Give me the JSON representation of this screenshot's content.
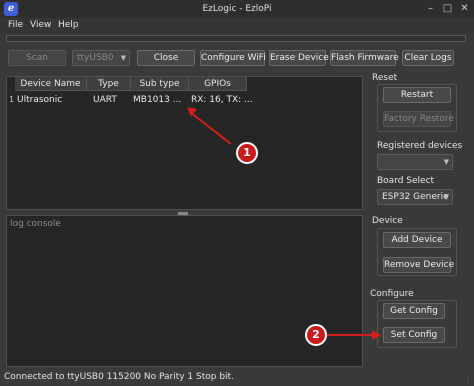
{
  "window": {
    "title": "EzLogic - EzloPi",
    "app_icon_glyph": "ℯ"
  },
  "menu": [
    "File",
    "View",
    "Help"
  ],
  "toolbar": {
    "scan_label": "Scan",
    "port_value": "ttyUSB0",
    "close_label": "Close",
    "configure_wifi_label": "Configure WiFi",
    "erase_device_label": "Erase Device",
    "flash_firmware_label": "Flash Firmware",
    "clear_logs_label": "Clear Logs"
  },
  "table": {
    "columns": [
      "Device Name",
      "Type",
      "Sub type",
      "GPIOs"
    ],
    "rows": [
      {
        "num": "1",
        "device_name": "Ultrasonic",
        "type": "UART",
        "sub_type": "MB1013 ...",
        "gpios": "RX: 16, TX: ..."
      }
    ]
  },
  "console": {
    "placeholder": "log console"
  },
  "sidebar": {
    "reset_label": "Reset",
    "restart_label": "Restart",
    "factory_restore_label": "Factory Restore",
    "registered_devices_label": "Registered devices",
    "registered_devices_value": "",
    "board_select_label": "Board Select",
    "board_value": "ESP32 Generic",
    "device_label": "Device",
    "add_device_label": "Add Device",
    "remove_device_label": "Remove Device",
    "configure_label": "Configure",
    "get_config_label": "Get Config",
    "set_config_label": "Set Config"
  },
  "status_bar": {
    "text": "Connected to ttyUSB0 115200 No Parity 1 Stop bit."
  },
  "annotations": [
    {
      "label": "1",
      "color": "#c81c1c"
    },
    {
      "label": "2",
      "color": "#c81c1c"
    }
  ]
}
